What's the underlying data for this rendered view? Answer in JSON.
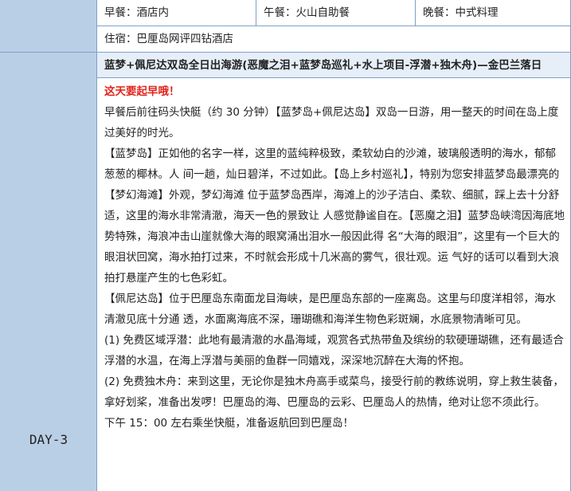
{
  "meals": {
    "breakfast": "早餐：酒店内",
    "lunch": "午餐：火山自助餐",
    "dinner": "晚餐：中式料理"
  },
  "stay": "住宿：巴厘岛网评四钻酒店",
  "day_label": "DAY-3",
  "title": "蓝梦+佩尼达双岛全日出海游(恶魔之泪+蓝梦岛巡礼+水上项目-浮潜+独木舟)—金巴兰落日",
  "content": {
    "alert": "这天要起早哦！",
    "p1": "早餐后前往码头快艇（约 30 分钟）【蓝梦岛+佩尼达岛】双岛一日游，用一整天的时间在岛上度过美好的时光。",
    "p2": "【蓝梦岛】正如他的名字一样，这里的蓝纯粹极致，柔软幼白的沙滩，玻璃般透明的海水，郁郁葱葱的椰林。人 间一趟，灿日碧洋，不过如此。【岛上乡村巡礼】，特别为您安排蓝梦岛最漂亮的【梦幻海滩】外观，梦幻海滩 位于蓝梦岛西岸，海滩上的沙子洁白、柔软、细腻，踩上去十分舒适，这里的海水非常清澈，海天一色的景致让 人感觉静谧自在。【恶魔之泪】蓝梦岛峡湾因海底地势特殊，海浪冲击山崖就像大海的眼窝涌出泪水一般因此得 名“大海的眼泪”，这里有一个巨大的眼泪状回窝，海水拍打过来，不时就会形成十几米高的雾气，很壮观。运 气好的话可以看到大浪拍打悬崖产生的七色彩虹。",
    "p3": "【佩尼达岛】位于巴厘岛东南面龙目海峡，是巴厘岛东部的一座离岛。这里与印度洋相邻，海水清澈见底十分通 透，水面离海底不深，珊瑚礁和海洋生物色彩斑斓，水底景物清晰可见。",
    "p4": "(1) 免费区域浮潜：此地有最清澈的水晶海域，观赏各式热带鱼及缤纷的软硬珊瑚礁，还有最适合浮潜的水温，在海上浮潜与美丽的鱼群一同嬉戏，深深地沉醉在大海的怀抱。",
    "p5": " (2) 免费独木舟：来到这里，无论你是独木舟高手或菜鸟，接受行前的教练说明，穿上救生装备，拿好划桨，准备出发啰！巴厘岛的海、巴厘岛的云彩、巴厘岛人的热情，绝对让您不须此行。",
    "p6": "下午 15：00 左右乘坐快艇，准备返航回到巴厘岛！"
  },
  "colors": {
    "left_panel": "#b9cfe6",
    "border": "#7fa1c6",
    "title_bg": "#e6eef8",
    "alert": "#e0241b"
  }
}
